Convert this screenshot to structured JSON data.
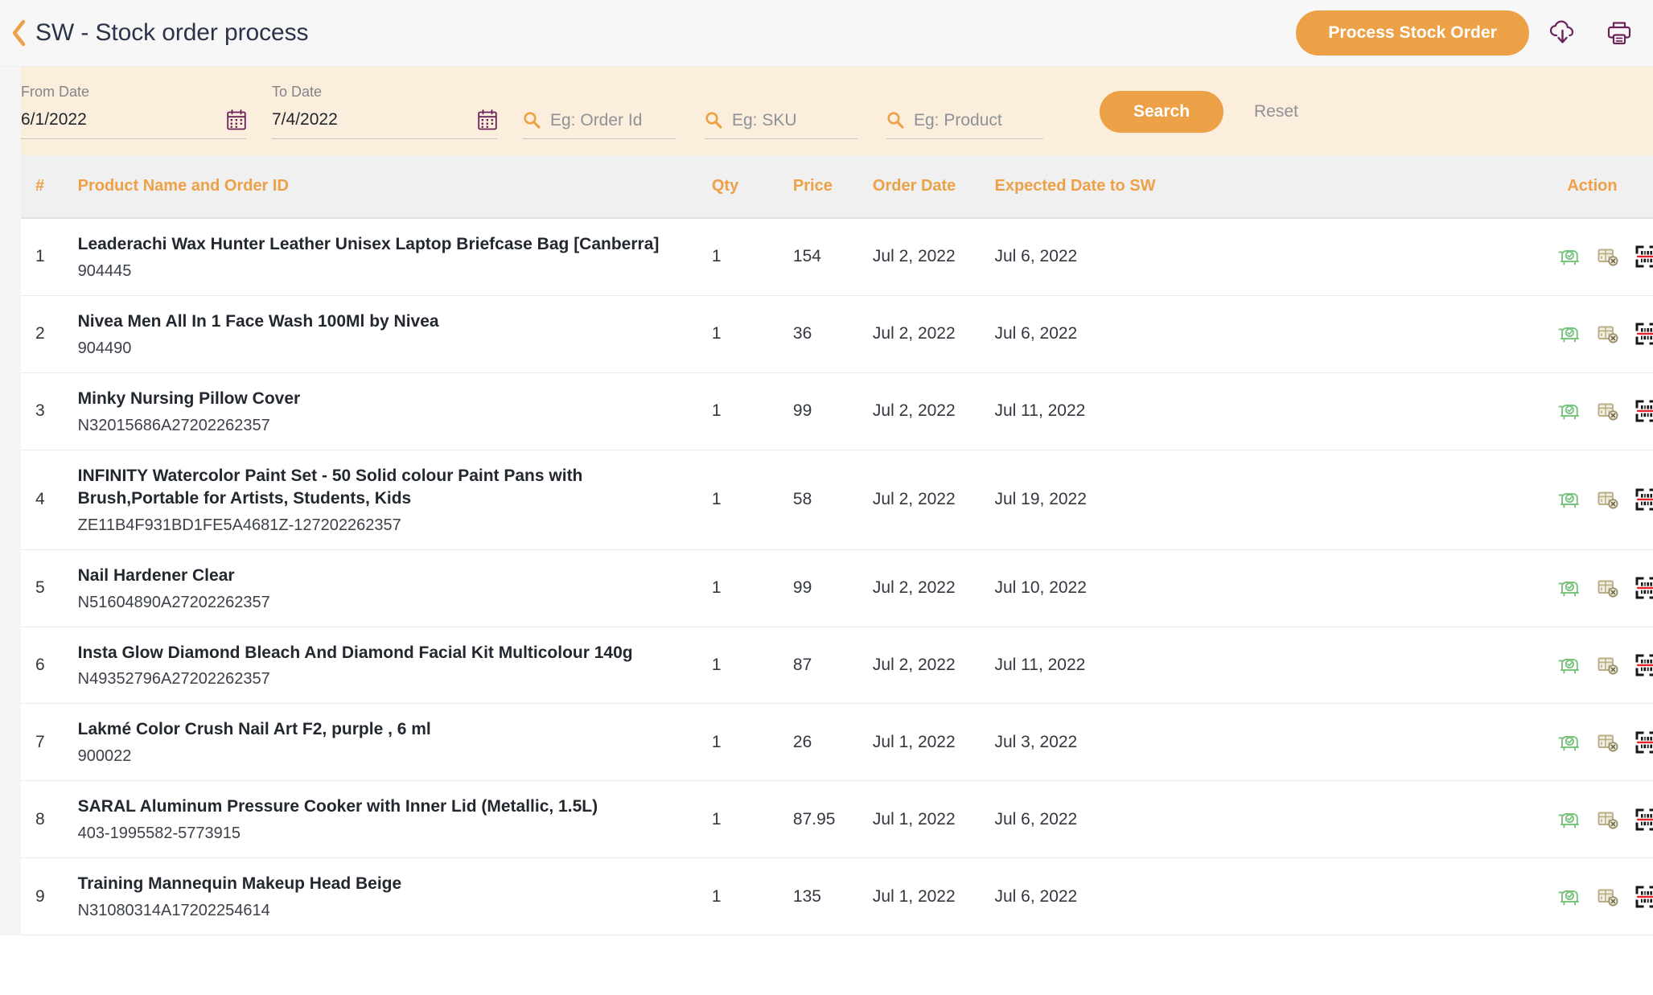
{
  "header": {
    "back_icon": "chevron-left-icon",
    "title": "SW - Stock order process",
    "process_button": "Process Stock Order",
    "download_icon": "cloud-download-icon",
    "print_icon": "print-icon"
  },
  "filters": {
    "from_date": {
      "label": "From Date",
      "value": "6/1/2022",
      "icon": "calendar-icon"
    },
    "to_date": {
      "label": "To Date",
      "value": "7/4/2022",
      "icon": "calendar-icon"
    },
    "order_id": {
      "placeholder": "Eg: Order Id",
      "value": "",
      "icon": "search-icon"
    },
    "sku": {
      "placeholder": "Eg: SKU",
      "value": "",
      "icon": "search-icon"
    },
    "product": {
      "placeholder": "Eg: Product",
      "value": "",
      "icon": "search-icon"
    },
    "search_button": "Search",
    "reset_button": "Reset"
  },
  "table": {
    "columns": {
      "num": "#",
      "product": "Product Name and Order ID",
      "qty": "Qty",
      "price": "Price",
      "order_date": "Order Date",
      "expected_date": "Expected Date to SW",
      "action": "Action"
    },
    "action_icons": [
      "delivery-received-icon",
      "delivery-cancelled-icon",
      "barcode-scan-icon",
      "cancel-circle-icon",
      "notes-clipboard-icon"
    ],
    "rows": [
      {
        "num": "1",
        "name": "Leaderachi Wax Hunter Leather Unisex Laptop Briefcase Bag [Canberra]",
        "order_id": "904445",
        "qty": "1",
        "price": "154",
        "order_date": "Jul 2, 2022",
        "expected_date": "Jul 6, 2022"
      },
      {
        "num": "2",
        "name": "Nivea Men All In 1 Face Wash 100Ml by Nivea",
        "order_id": "904490",
        "qty": "1",
        "price": "36",
        "order_date": "Jul 2, 2022",
        "expected_date": "Jul 6, 2022"
      },
      {
        "num": "3",
        "name": "Minky Nursing Pillow Cover",
        "order_id": "N32015686A27202262357",
        "qty": "1",
        "price": "99",
        "order_date": "Jul 2, 2022",
        "expected_date": "Jul 11, 2022"
      },
      {
        "num": "4",
        "name": "INFINITY Watercolor Paint Set - 50 Solid colour Paint Pans with Brush,Portable for Artists, Students, Kids",
        "order_id": "ZE11B4F931BD1FE5A4681Z-127202262357",
        "qty": "1",
        "price": "58",
        "order_date": "Jul 2, 2022",
        "expected_date": "Jul 19, 2022"
      },
      {
        "num": "5",
        "name": "Nail Hardener Clear",
        "order_id": "N51604890A27202262357",
        "qty": "1",
        "price": "99",
        "order_date": "Jul 2, 2022",
        "expected_date": "Jul 10, 2022"
      },
      {
        "num": "6",
        "name": "Insta Glow Diamond Bleach And Diamond Facial Kit Multicolour 140g",
        "order_id": "N49352796A27202262357",
        "qty": "1",
        "price": "87",
        "order_date": "Jul 2, 2022",
        "expected_date": "Jul 11, 2022"
      },
      {
        "num": "7",
        "name": "Lakmé Color Crush Nail Art F2, purple , 6 ml",
        "order_id": "900022",
        "qty": "1",
        "price": "26",
        "order_date": "Jul 1, 2022",
        "expected_date": "Jul 3, 2022"
      },
      {
        "num": "8",
        "name": "SARAL Aluminum Pressure Cooker with Inner Lid (Metallic, 1.5L)",
        "order_id": "403-1995582-5773915",
        "qty": "1",
        "price": "87.95",
        "order_date": "Jul 1, 2022",
        "expected_date": "Jul 6, 2022"
      },
      {
        "num": "9",
        "name": "Training Mannequin Makeup Head Beige",
        "order_id": "N31080314A17202254614",
        "qty": "1",
        "price": "135",
        "order_date": "Jul 1, 2022",
        "expected_date": "Jul 6, 2022"
      }
    ]
  },
  "colors": {
    "accent_orange": "#eda147",
    "header_bg": "#f7f7f7",
    "filter_bg": "#fbeedc",
    "table_header_bg": "#f0f0f0",
    "icon_purple": "#6b2259",
    "title_text": "#2b3349",
    "green_icon": "#7bc47f",
    "khaki_icon": "#b8ae86",
    "red_scan_line": "#e8202a"
  }
}
